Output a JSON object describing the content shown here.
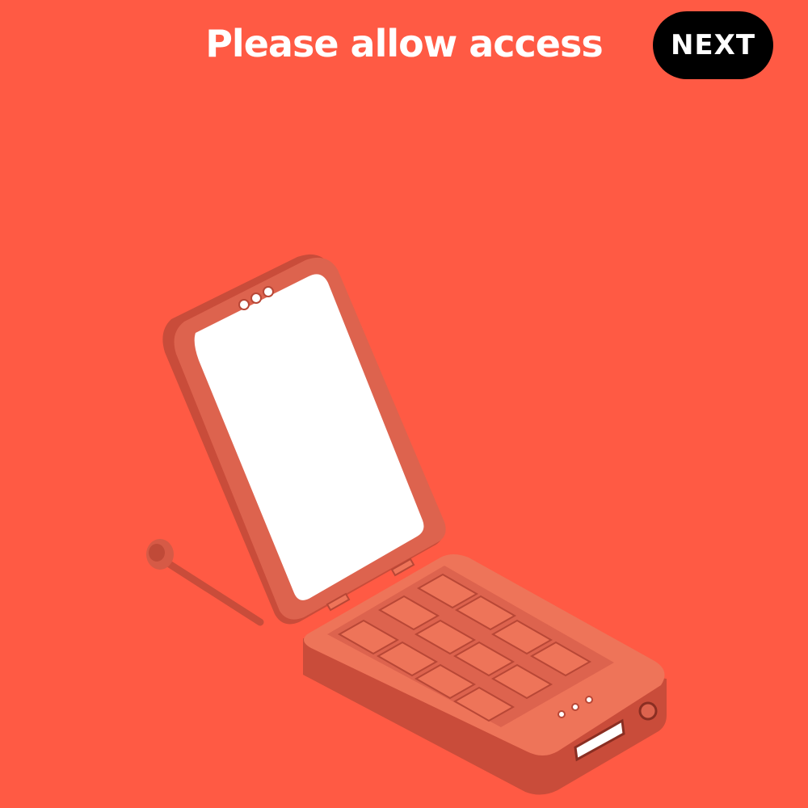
{
  "header": {
    "title": "Please allow access",
    "next_label": "NEXT"
  },
  "illustration": {
    "icon": "flip-phone-illustration"
  },
  "colors": {
    "background": "#FF5A44",
    "phone_light": "#EE7459",
    "phone_mid": "#DA5F4A",
    "phone_dark": "#B84736",
    "screen": "#FFFFFF",
    "button": "#000000"
  }
}
